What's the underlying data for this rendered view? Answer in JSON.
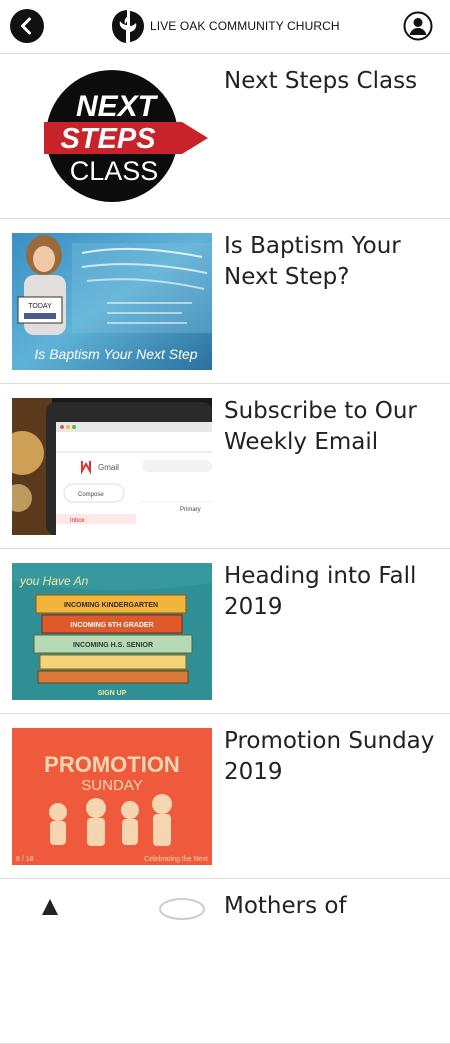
{
  "header": {
    "brand": "LIVE OAK COMMUNITY CHURCH",
    "back_icon": "chevron-left-icon",
    "profile_icon": "user-icon"
  },
  "items": [
    {
      "title": "Next Steps Class",
      "thumb": {
        "line1": "NEXT",
        "line2": "STEPS",
        "line3": "CLASS"
      }
    },
    {
      "title": "Is Baptism Your Next Step?",
      "thumb": {
        "caption": "Is Baptism Your Next Step",
        "sign_text": "TODAY"
      }
    },
    {
      "title": "Subscribe to Our Weekly Email",
      "thumb": {
        "app": "Gmail",
        "compose": "Compose",
        "inbox": "Inbox",
        "primary": "Primary"
      }
    },
    {
      "title": "Heading into Fall 2019",
      "thumb": {
        "headline": "you Have An",
        "book1": "INCOMING KINDERGARTEN",
        "book2": "INCOMING 6TH GRADER",
        "book3": "INCOMING H.S. SENIOR",
        "footer": "SIGN UP"
      }
    },
    {
      "title": "Promotion Sunday 2019",
      "thumb": {
        "line1": "PROMOTION",
        "line2": "SUNDAY",
        "footer_left": "8 / 18",
        "footer_right": "Celebrating the Next"
      }
    },
    {
      "title": "Mothers of",
      "thumb": {}
    }
  ],
  "colors": {
    "accent_red": "#c8222a",
    "promo_bg": "#f05a3c",
    "teal_bg": "#2f8f94"
  }
}
